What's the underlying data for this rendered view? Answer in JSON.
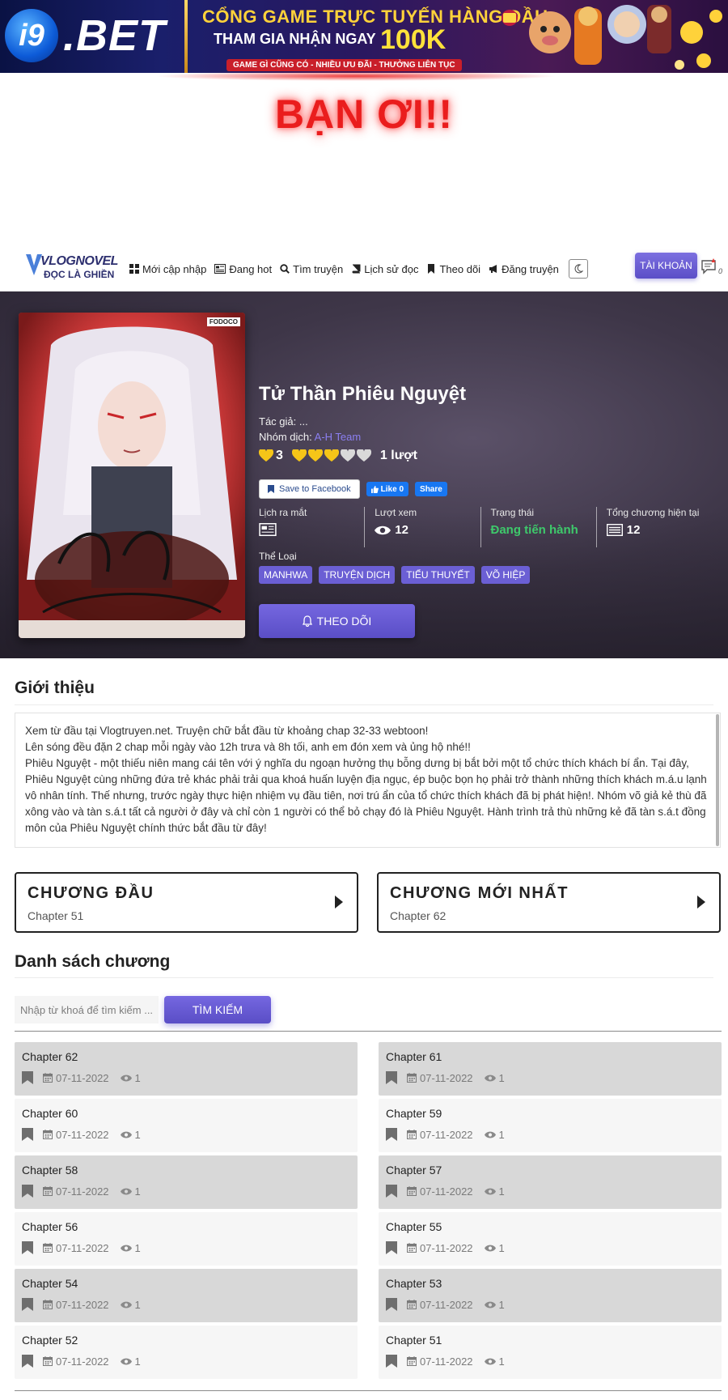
{
  "ad": {
    "logo_i9": "i9",
    "logo_bet": ".BET",
    "line1": "CỔNG GAME TRỰC TUYẾN HÀNG ĐẦU",
    "line2": "THAM GIA NHẬN NGAY",
    "bonus": "100K",
    "line3": "GAME GÌ CŨNG CÓ - NHIỀU ƯU ĐÃI - THƯỞNG LIÊN TỤC"
  },
  "headline": "BẠN ƠI!!",
  "nav": {
    "logo_top": "VLOGNOVEL",
    "logo_bottom": "ĐỌC LÀ GHIỀN",
    "items": [
      {
        "label": "Mới cập nhập",
        "icon": "grid-icon"
      },
      {
        "label": "Đang hot",
        "icon": "newspaper-icon"
      },
      {
        "label": "Tìm truyện",
        "icon": "search-icon"
      },
      {
        "label": "Lịch sử đọc",
        "icon": "book-icon"
      },
      {
        "label": "Theo dõi",
        "icon": "bookmark-icon"
      },
      {
        "label": "Đăng truyện",
        "icon": "megaphone-icon"
      }
    ],
    "account": "TÀI KHOẢN",
    "notif_count": "0"
  },
  "story": {
    "title": "Tử Thần Phiêu Nguyệt",
    "author_label": "Tác giả:",
    "author": "...",
    "group_label": "Nhóm dịch:",
    "group": "A-H Team",
    "rating_score": "3",
    "rating_stars_filled": 3,
    "rating_stars_total": 5,
    "rating_count": "1 lượt",
    "save_fb": "Save to Facebook",
    "fb_like": "Like 0",
    "fb_share": "Share",
    "stats": [
      {
        "label": "Lịch ra mắt",
        "value": ""
      },
      {
        "label": "Lượt xem",
        "value": "12"
      },
      {
        "label": "Trạng thái",
        "value": "Đang tiến hành"
      },
      {
        "label": "Tổng chương hiện tại",
        "value": "12"
      }
    ],
    "genre_label": "Thể Loại",
    "genres": [
      "MANHWA",
      "TRUYỆN DỊCH",
      "TIỂU THUYẾT",
      "VÕ HIỆP"
    ],
    "follow": "THEO DÕI",
    "cover_badge": "FODOCO"
  },
  "intro": {
    "title": "Giới thiệu",
    "lines": [
      "Xem từ đầu tại Vlogtruyen.net. Truyện chữ bắt đầu từ khoảng chap 32-33 webtoon!",
      "Lên sóng đều đặn 2 chap mỗi ngày vào 12h trưa và 8h tối, anh em đón xem và ủng hộ nhé!!",
      "Phiêu Nguyệt - một thiếu niên mang cái tên với ý nghĩa du ngoạn hưởng thụ bỗng dưng bị bắt bởi một tổ chức thích khách bí ẩn. Tại đây, Phiêu Nguyệt cùng những đứa trẻ khác phải trải qua khoá huấn luyện địa ngục, ép buộc bọn họ phải trở thành những thích khách m.á.u lạnh vô nhân tính. Thế nhưng, trước ngày thực hiện nhiệm vụ đầu tiên, nơi trú ẩn của tổ chức thích khách đã bị phát hiện!. Nhóm võ giả kẻ thù đã xông vào và tàn s.á.t tất cả người ở đây và chỉ còn 1 người có thể bỏ chạy đó là Phiêu Nguyệt. Hành trình trả thù những kẻ đã tàn s.á.t đồng môn của Phiêu Nguyệt chính thức bắt đầu từ đây!"
    ]
  },
  "first_chapter": {
    "title": "CHƯƠNG ĐẦU",
    "sub": "Chapter 51"
  },
  "latest_chapter": {
    "title": "CHƯƠNG MỚI NHẤT",
    "sub": "Chapter 62"
  },
  "chapters": {
    "title": "Danh sách chương",
    "search_placeholder": "Nhập từ khoá để tìm kiếm ...",
    "search_button": "TÌM KIẾM",
    "items": [
      {
        "name": "Chapter 62",
        "date": "07-11-2022",
        "views": "1"
      },
      {
        "name": "Chapter 61",
        "date": "07-11-2022",
        "views": "1"
      },
      {
        "name": "Chapter 60",
        "date": "07-11-2022",
        "views": "1"
      },
      {
        "name": "Chapter 59",
        "date": "07-11-2022",
        "views": "1"
      },
      {
        "name": "Chapter 58",
        "date": "07-11-2022",
        "views": "1"
      },
      {
        "name": "Chapter 57",
        "date": "07-11-2022",
        "views": "1"
      },
      {
        "name": "Chapter 56",
        "date": "07-11-2022",
        "views": "1"
      },
      {
        "name": "Chapter 55",
        "date": "07-11-2022",
        "views": "1"
      },
      {
        "name": "Chapter 54",
        "date": "07-11-2022",
        "views": "1"
      },
      {
        "name": "Chapter 53",
        "date": "07-11-2022",
        "views": "1"
      },
      {
        "name": "Chapter 52",
        "date": "07-11-2022",
        "views": "1"
      },
      {
        "name": "Chapter 51",
        "date": "07-11-2022",
        "views": "1"
      }
    ]
  },
  "colors": {
    "accent": "#6b5fd4",
    "status_green": "#3ec96b",
    "headline_red": "#ea1d1d",
    "heart_gold": "#f5c518"
  }
}
